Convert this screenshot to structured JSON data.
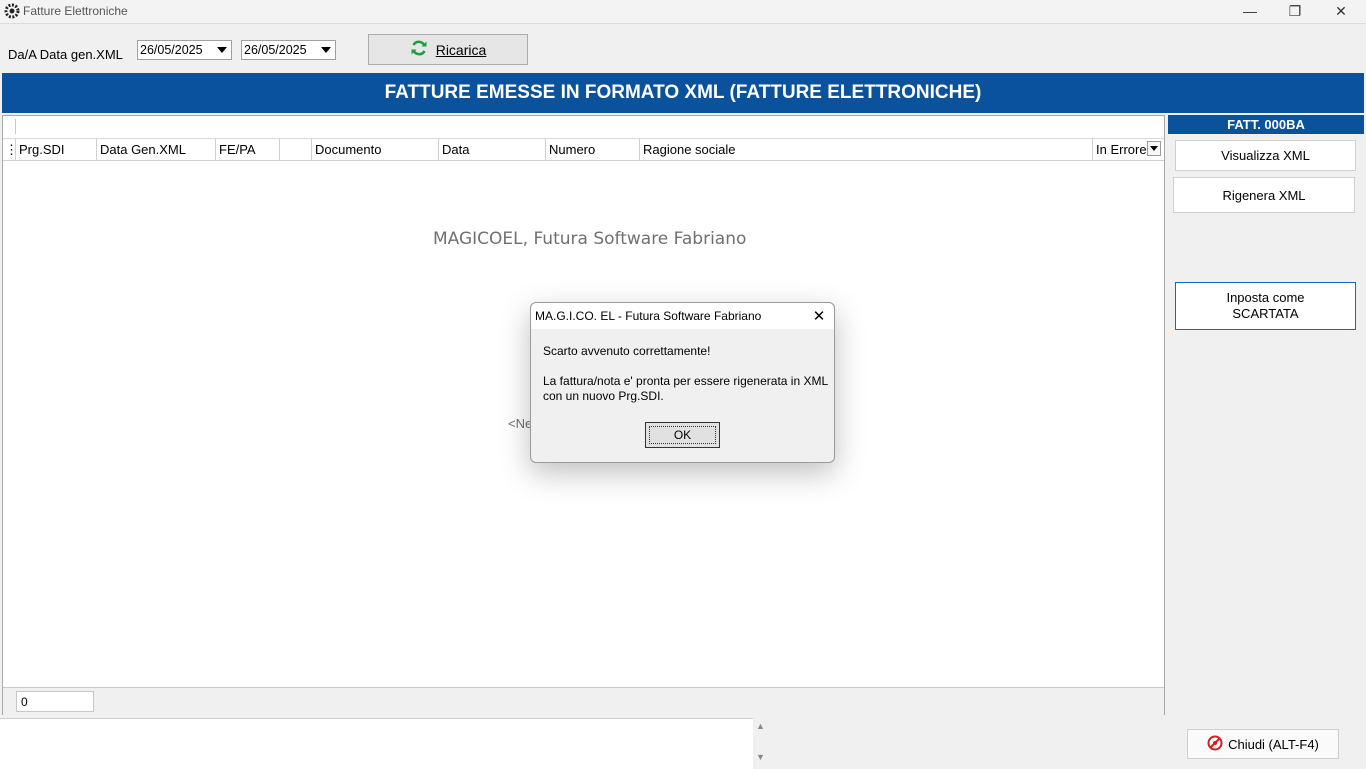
{
  "window": {
    "title": "Fatture Elettroniche",
    "minimize_glyph": "—",
    "restore_glyph": "❐",
    "close_glyph": "✕"
  },
  "toolbar": {
    "range_label": "Da/A Data gen.XML",
    "date_from": "26/05/2025",
    "date_to": "26/05/2025",
    "reload_label": "Ricarica"
  },
  "banner": {
    "title": "FATTURE EMESSE IN FORMATO XML (FATTURE ELETTRONICHE)"
  },
  "grid": {
    "columns": [
      "Prg.SDI",
      "Data Gen.XML",
      "FE/PA",
      "",
      "Documento",
      "Data",
      "Numero",
      "Ragione sociale",
      "In Errore"
    ],
    "watermark": "MAGICOEL, Futura Software Fabriano",
    "partial_text": "<Ne",
    "row_count": "0"
  },
  "side_panel": {
    "title": "FATT. 000BA",
    "view_xml_label": "Visualizza  XML",
    "regen_xml_label": "Rigenera XML",
    "set_rejected_label_1": "Inposta come",
    "set_rejected_label_2": "SCARTATA"
  },
  "footer": {
    "close_label": "Chiudi (ALT-F4)"
  },
  "dialog": {
    "title": "MA.G.I.CO. EL - Futura Software Fabriano",
    "message_1": "Scarto avvenuto correttamente!",
    "message_2": "La fattura/nota e' pronta per essere rigenerata in XML",
    "message_3": "con un nuovo Prg.SDI.",
    "ok_label": "OK"
  },
  "colors": {
    "banner": "#0a539c",
    "reload_icon": "#1e9e3e",
    "close_icon": "#d22020"
  }
}
